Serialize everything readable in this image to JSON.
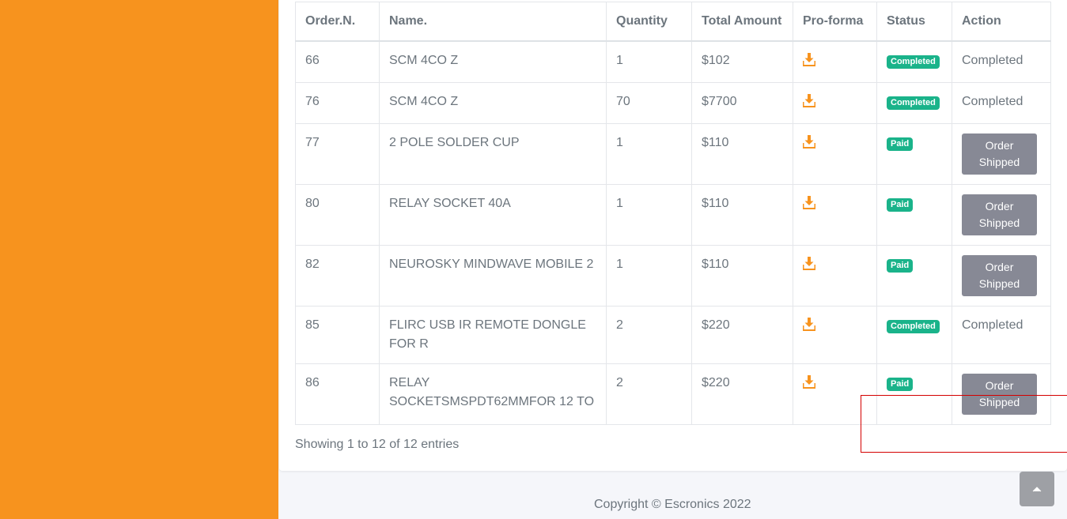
{
  "colors": {
    "sidebar": "#f7931e",
    "badge_green": "#1ab38a",
    "button_gray": "#878995",
    "icon_orange": "#f7931e",
    "highlight_red": "#d40000"
  },
  "table": {
    "rows": [
      {
        "order": "66",
        "name": "SCM 4CO Z",
        "qty": "1",
        "amount": "$102",
        "status": "Completed",
        "action": "Completed",
        "action_type": "text"
      },
      {
        "order": "76",
        "name": "SCM 4CO Z",
        "qty": "70",
        "amount": "$7700",
        "status": "Completed",
        "action": "Completed",
        "action_type": "text"
      },
      {
        "order": "77",
        "name": "2 POLE SOLDER CUP",
        "qty": "1",
        "amount": "$110",
        "status": "Paid",
        "action": "Order Shipped",
        "action_type": "button"
      },
      {
        "order": "80",
        "name": "RELAY SOCKET 40A",
        "qty": "1",
        "amount": "$110",
        "status": "Paid",
        "action": "Order Shipped",
        "action_type": "button"
      },
      {
        "order": "82",
        "name": "NEUROSKY MINDWAVE MOBILE 2",
        "qty": "1",
        "amount": "$110",
        "status": "Paid",
        "action": "Order Shipped",
        "action_type": "button"
      },
      {
        "order": "85",
        "name": "FLIRC USB IR REMOTE DONGLE FOR R",
        "qty": "2",
        "amount": "$220",
        "status": "Completed",
        "action": "Completed",
        "action_type": "text"
      },
      {
        "order": "86",
        "name": "RELAY SOCKETSMSPDT62MMFOR 12 TO",
        "qty": "2",
        "amount": "$220",
        "status": "Paid",
        "action": "Order Shipped",
        "action_type": "button"
      }
    ],
    "footer_headers": {
      "order": "Order.N.",
      "name": "Name.",
      "qty": "Quantity",
      "amount": "Total Amount",
      "proforma": "Pro-forma",
      "status": "Status",
      "action": "Action"
    },
    "proforma_icon": "download-icon"
  },
  "entries_info": "Showing 1 to 12 of 12 entries",
  "copyright": "Copyright © Escronics 2022",
  "scroll_top_icon": "chevron-up-icon"
}
